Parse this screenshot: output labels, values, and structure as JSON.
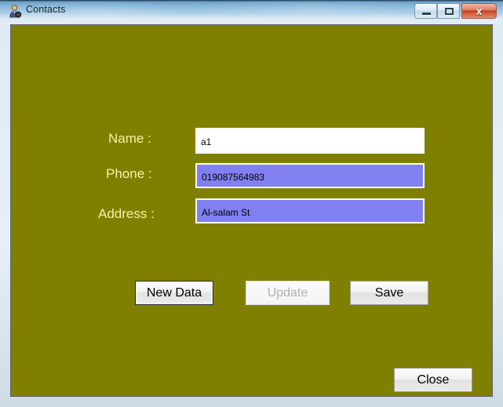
{
  "window": {
    "title": "Contacts",
    "icon": "user-contact-icon",
    "client_background": "#808000",
    "controls": {
      "minimize_label": "–",
      "maximize_label": "□",
      "close_label": "x"
    }
  },
  "form": {
    "fields": [
      {
        "label": "Name :",
        "value": "a1",
        "placeholder": "",
        "background": "#ffffff",
        "state": "editable"
      },
      {
        "label": "Phone :",
        "value": "019087564983",
        "placeholder": "",
        "background": "#8080f0",
        "state": "editable"
      },
      {
        "label": "Address :",
        "value": "Al-salam St",
        "placeholder": "",
        "background": "#8080f0",
        "state": "editable"
      }
    ],
    "label_color": "#f2f2a8"
  },
  "buttons": {
    "new_data": {
      "label": "New Data",
      "state": "focused"
    },
    "update": {
      "label": "Update",
      "state": "disabled"
    },
    "save": {
      "label": "Save",
      "state": "enabled"
    },
    "close": {
      "label": "Close",
      "state": "enabled"
    }
  }
}
